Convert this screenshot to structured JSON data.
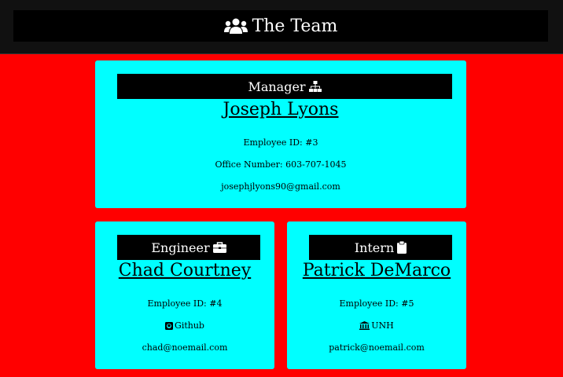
{
  "header": {
    "title": "The Team",
    "icon": "users-icon"
  },
  "manager": {
    "role": "Manager",
    "role_icon": "sitemap-icon",
    "name": "Joseph Lyons",
    "id": "Employee ID: #3",
    "office": "Office Number: 603-707-1045",
    "email": "josephjlyons90@gmail.com"
  },
  "engineer": {
    "role": "Engineer",
    "role_icon": "briefcase-icon",
    "name": "Chad Courtney",
    "id": "Employee ID: #4",
    "github": "Github",
    "github_icon": "github-icon",
    "email": "chad@noemail.com"
  },
  "intern": {
    "role": "Intern",
    "role_icon": "clipboard-icon",
    "name": "Patrick DeMarco",
    "id": "Employee ID: #5",
    "school": "UNH",
    "school_icon": "university-icon",
    "email": "patrick@noemail.com"
  },
  "colors": {
    "page_bg": "#ff0000",
    "card_bg": "#00ffff",
    "bar_bg": "#000000"
  }
}
